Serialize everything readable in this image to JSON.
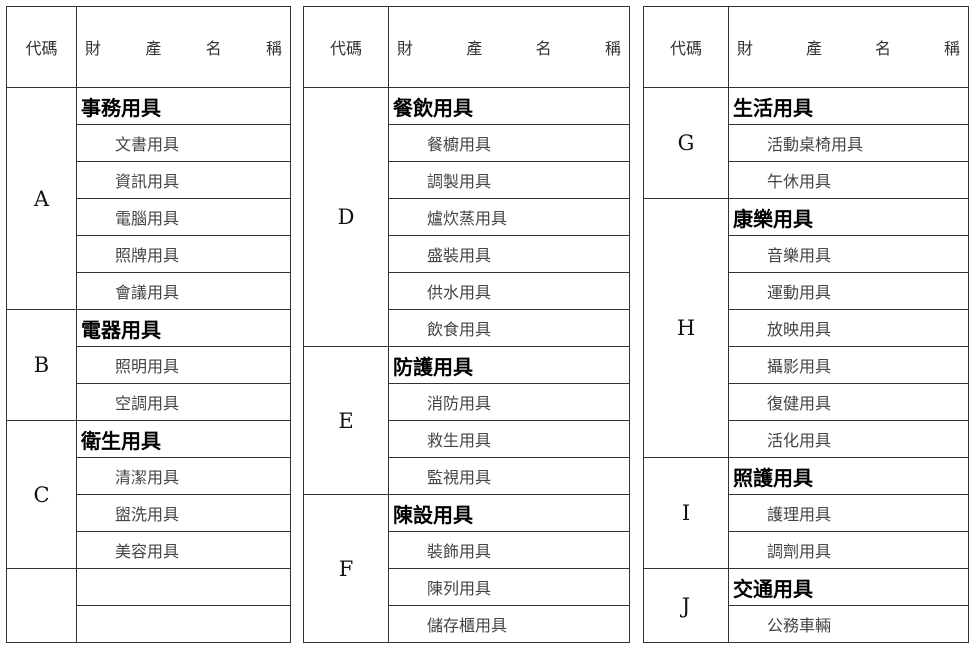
{
  "header": {
    "code_label": "代碼",
    "name_chars": [
      "財",
      "產",
      "名",
      "稱"
    ]
  },
  "columns": [
    {
      "groups": [
        {
          "code": "A",
          "category": "事務用具",
          "items": [
            "文書用具",
            "資訊用具",
            "電腦用具",
            "照牌用具",
            "會議用具"
          ]
        },
        {
          "code": "B",
          "category": "電器用具",
          "items": [
            "照明用具",
            "空調用具"
          ]
        },
        {
          "code": "C",
          "category": "衛生用具",
          "items": [
            "清潔用具",
            "盥洗用具",
            "美容用具"
          ]
        }
      ]
    },
    {
      "groups": [
        {
          "code": "D",
          "category": "餐飲用具",
          "items": [
            "餐櫥用具",
            "調製用具",
            "爐炊蒸用具",
            "盛裝用具",
            "供水用具",
            "飲食用具"
          ]
        },
        {
          "code": "E",
          "category": "防護用具",
          "items": [
            "消防用具",
            "救生用具",
            "監視用具"
          ]
        },
        {
          "code": "F",
          "category": "陳設用具",
          "items": [
            "裝飾用具",
            "陳列用具",
            "儲存櫃用具"
          ]
        }
      ]
    },
    {
      "groups": [
        {
          "code": "G",
          "category": "生活用具",
          "items": [
            "活動桌椅用具",
            "午休用具"
          ]
        },
        {
          "code": "H",
          "category": "康樂用具",
          "items": [
            "音樂用具",
            "運動用具",
            "放映用具",
            "攝影用具",
            "復健用具",
            "活化用具"
          ]
        },
        {
          "code": "I",
          "category": "照護用具",
          "items": [
            "護理用具",
            "調劑用具"
          ]
        },
        {
          "code": "J",
          "category": "交通用具",
          "items": [
            "公務車輛"
          ]
        }
      ]
    }
  ]
}
